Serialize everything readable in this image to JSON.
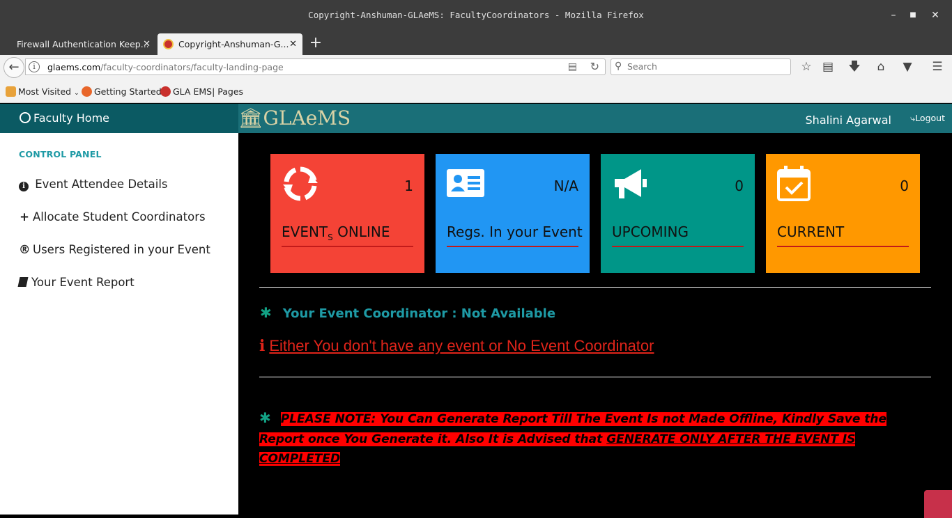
{
  "window": {
    "title": "Copyright-Anshuman-GLAeMS: FacultyCoordinators - Mozilla Firefox"
  },
  "tabs": [
    {
      "label": "Firewall Authentication Keep..."
    },
    {
      "label": "Copyright-Anshuman-G..."
    }
  ],
  "navbar": {
    "url_domain": "glaems.com",
    "url_path": "/faculty-coordinators/faculty-landing-page",
    "search_placeholder": "Search"
  },
  "bookmarks": [
    {
      "label": "Most Visited"
    },
    {
      "label": "Getting Started"
    },
    {
      "label": "GLA EMS| Pages"
    }
  ],
  "sidebar": {
    "home_label": "Faculty Home",
    "section_label": "CONTROL PANEL",
    "items": [
      {
        "label": "Event Attendee Details"
      },
      {
        "label": "Allocate Student Coordinators"
      },
      {
        "label": "Users Registered in your Event"
      },
      {
        "label": "Your Event Report"
      }
    ]
  },
  "header": {
    "logo_text": "GLAeMS",
    "user_name": "Shalini Agarwal",
    "logout_label": "Logout"
  },
  "cards": [
    {
      "count": "1",
      "label_main": "EVENT",
      "label_sub": "S",
      "label_rest": " ONLINE",
      "color": "#f44336",
      "icon": "refresh-icon"
    },
    {
      "count": "N/A",
      "label": "Regs. In your Event",
      "color": "#2196f3",
      "icon": "id-card-icon"
    },
    {
      "count": "0",
      "label": "UPCOMING",
      "color": "#009688",
      "icon": "megaphone-icon"
    },
    {
      "count": "0",
      "label": "CURRENT",
      "color": "#ff9800",
      "icon": "calendar-check-icon"
    }
  ],
  "coordinator": {
    "text": "Your Event Coordinator : Not Available"
  },
  "warning": {
    "text": "Either You don't have any event or No Event Coordinator"
  },
  "note": {
    "part1": "PLEASE NOTE: You Can Generate Report Till The Event Is not Made Offline, Kindly Save the Report once You Generate it. Also It is Advised that ",
    "part2": "GENERATE ONLY AFTER THE EVENT IS COMPLETED"
  },
  "colors": {
    "sidebar_header": "#0b5a63",
    "page_header": "#1a6f78",
    "accent_teal": "#1e9aa5",
    "warning_red": "#e0241a"
  }
}
